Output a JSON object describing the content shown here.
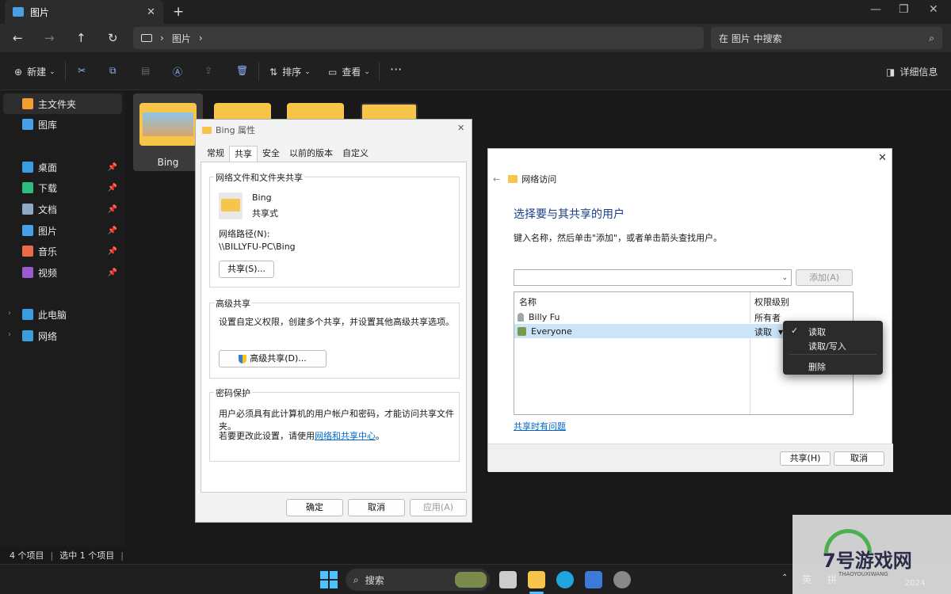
{
  "window": {
    "tab_title": "图片"
  },
  "nav": {
    "breadcrumb": "图片",
    "search_placeholder": "在 图片 中搜索"
  },
  "toolbar": {
    "new_label": "新建",
    "sort_label": "排序",
    "view_label": "查看",
    "details_label": "详细信息"
  },
  "sidebar": {
    "items": [
      {
        "label": "主文件夹",
        "icon": "home-icon",
        "color": "#f0a030"
      },
      {
        "label": "图库",
        "icon": "gallery-icon",
        "color": "#4aa0e6"
      },
      {
        "label": "桌面",
        "icon": "desktop-icon",
        "color": "#3b9ddd"
      },
      {
        "label": "下载",
        "icon": "download-icon",
        "color": "#2dbe7f"
      },
      {
        "label": "文档",
        "icon": "document-icon",
        "color": "#8fa8c8"
      },
      {
        "label": "图片",
        "icon": "pictures-icon",
        "color": "#4aa0e6"
      },
      {
        "label": "音乐",
        "icon": "music-icon",
        "color": "#e86c4a"
      },
      {
        "label": "视频",
        "icon": "video-icon",
        "color": "#9b59d0"
      },
      {
        "label": "此电脑",
        "icon": "pc-icon",
        "color": "#3b9ddd"
      },
      {
        "label": "网络",
        "icon": "network-icon",
        "color": "#3b9ddd"
      }
    ]
  },
  "content": {
    "folder_bing_label": "Bing"
  },
  "status": {
    "item_count": "4 个项目",
    "selected": "选中 1 个项目"
  },
  "taskbar": {
    "search": "搜索",
    "ime_lang": "英",
    "ime_mode": "拼",
    "clock_year": "2024"
  },
  "props": {
    "title": "Bing 属性",
    "tabs": [
      "常规",
      "共享",
      "安全",
      "以前的版本",
      "自定义"
    ],
    "net_group": "网络文件和文件夹共享",
    "folder_name": "Bing",
    "folder_state": "共享式",
    "path_label": "网络路径(N):",
    "path_value": "\\\\BILLYFU-PC\\Bing",
    "share_btn": "共享(S)...",
    "adv_group": "高级共享",
    "adv_desc": "设置自定义权限，创建多个共享，并设置其他高级共享选项。",
    "adv_btn": "高级共享(D)...",
    "pw_group": "密码保护",
    "pw_desc": "用户必须具有此计算机的用户帐户和密码，才能访问共享文件夹。",
    "pw_change_prefix": "若要更改此设置，请使用",
    "pw_link": "网络和共享中心",
    "pw_change_suffix": "。",
    "ok": "确定",
    "cancel": "取消",
    "apply": "应用(A)"
  },
  "netaccess": {
    "title": "网络访问",
    "heading": "选择要与其共享的用户",
    "instruction": "键入名称，然后单击\"添加\"，或者单击箭头查找用户。",
    "add_btn": "添加(A)",
    "col_name": "名称",
    "col_level": "权限级别",
    "rows": [
      {
        "name": "Billy Fu",
        "level": "所有者"
      },
      {
        "name": "Everyone",
        "level": "读取"
      }
    ],
    "help_link": "共享时有问题",
    "share_btn": "共享(H)",
    "cancel_btn": "取消"
  },
  "menu": {
    "items": [
      "读取",
      "读取/写入",
      "删除"
    ],
    "checked": "读取"
  },
  "watermark": {
    "brand": "7号游戏网",
    "sub": "THAOYOUXIWANG"
  }
}
